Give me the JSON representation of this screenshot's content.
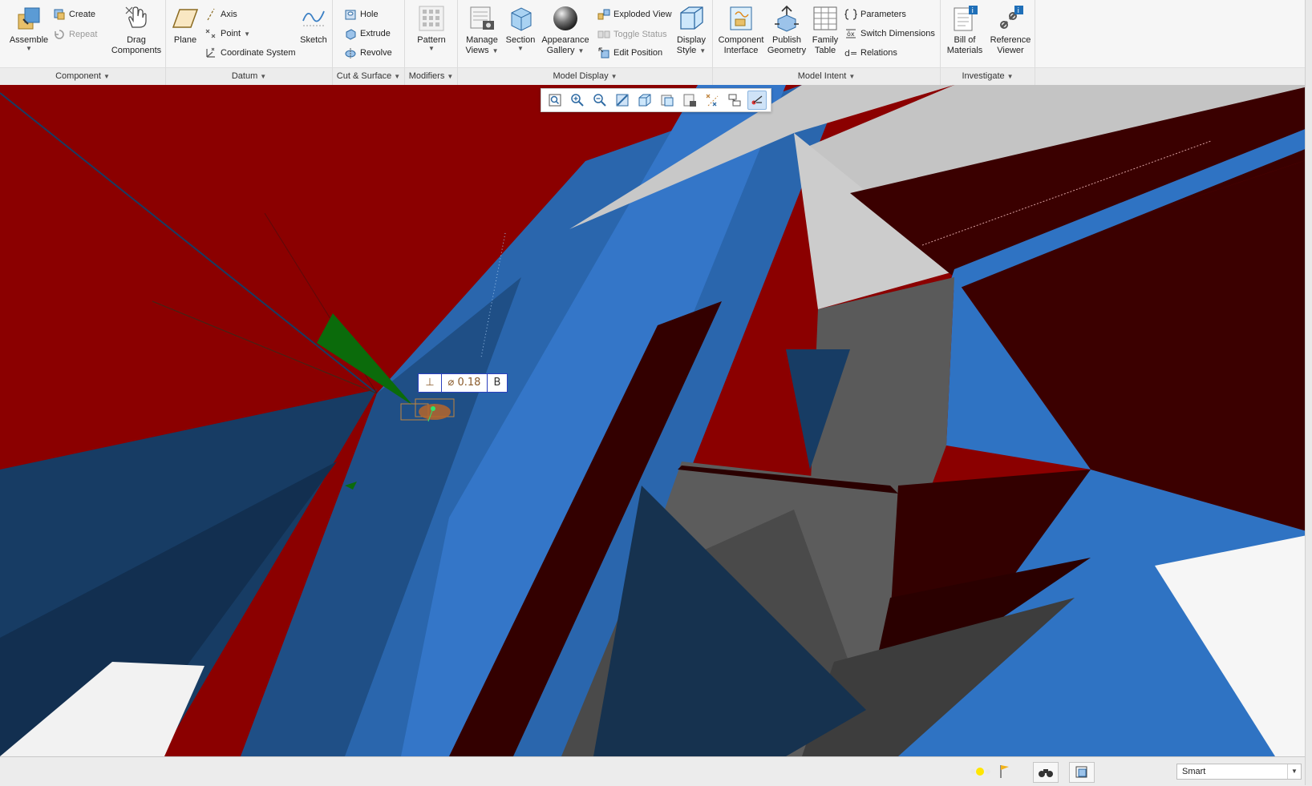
{
  "ribbon": {
    "component": {
      "label": "Component",
      "assemble": "Assemble",
      "create": "Create",
      "repeat": "Repeat",
      "drag_line1": "Drag",
      "drag_line2": "Components"
    },
    "datum": {
      "label": "Datum",
      "plane": "Plane",
      "axis": "Axis",
      "point": "Point",
      "coord": "Coordinate System",
      "sketch": "Sketch"
    },
    "cut_surface": {
      "label": "Cut & Surface",
      "hole": "Hole",
      "extrude": "Extrude",
      "revolve": "Revolve"
    },
    "modifiers": {
      "label": "Modifiers",
      "pattern": "Pattern"
    },
    "model_display": {
      "label": "Model Display",
      "manage_views_l1": "Manage",
      "manage_views_l2": "Views",
      "section": "Section",
      "appearance_l1": "Appearance",
      "appearance_l2": "Gallery",
      "exploded_view": "Exploded View",
      "toggle_status": "Toggle Status",
      "edit_position": "Edit Position",
      "display_style_l1": "Display",
      "display_style_l2": "Style"
    },
    "model_intent": {
      "label": "Model Intent",
      "component_interface_l1": "Component",
      "component_interface_l2": "Interface",
      "publish_geometry_l1": "Publish",
      "publish_geometry_l2": "Geometry",
      "family_table_l1": "Family",
      "family_table_l2": "Table",
      "parameters": "Parameters",
      "switch_dimensions": "Switch Dimensions",
      "relations": "Relations"
    },
    "investigate": {
      "label": "Investigate",
      "bom_l1": "Bill of",
      "bom_l2": "Materials",
      "reference_viewer_l1": "Reference",
      "reference_viewer_l2": "Viewer"
    }
  },
  "view_toolbar": {
    "icons": [
      "refit-icon",
      "zoom-in-icon",
      "zoom-out-icon",
      "repaint-icon",
      "display-style-icon",
      "saved-views-icon",
      "view-manager-icon",
      "datum-display-icon",
      "annotation-display-icon",
      "spin-center-icon"
    ]
  },
  "annotation": {
    "perp_symbol": "⊥",
    "tolerance": "⌀ 0.18",
    "datum_ref": "B"
  },
  "statusbar": {
    "filter_value": "Smart"
  },
  "colors": {
    "viewport_red": "#8b0000",
    "blue_light": "#2f73c3",
    "blue_dark": "#173c64",
    "grey": "#5a5a5a",
    "light_grey": "#c8c8c8",
    "dark_maroon": "#330000"
  }
}
